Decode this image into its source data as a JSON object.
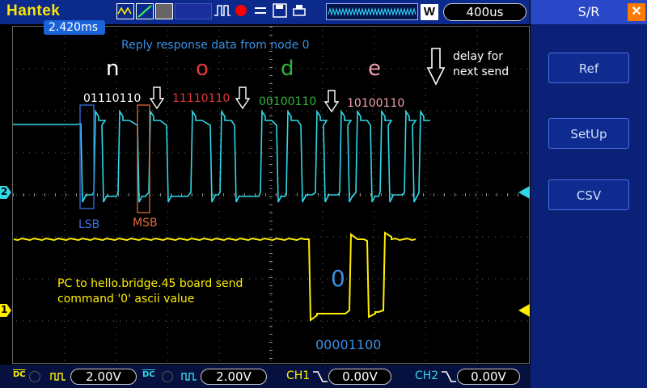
{
  "brand": "Hantek",
  "timebase": "400us",
  "trigger_btn": "W",
  "cursor_time": "2.420ms",
  "right_panel": {
    "title": "S/R",
    "close": "✕",
    "buttons": [
      "Ref",
      "SetUp",
      "CSV"
    ]
  },
  "channel_markers": {
    "ch1": "1",
    "ch2": "2"
  },
  "annotations": {
    "reply": "Reply response data from node 0",
    "letters": [
      "n",
      "o",
      "d",
      "e"
    ],
    "bytes": [
      "01110110",
      "11110110",
      "00100110",
      "10100110"
    ],
    "delay": "delay for next send",
    "lsb": "LSB",
    "msb": "MSB",
    "pc_line1": "PC to hello.bridge.45 board send",
    "pc_line2": "command '0' ascii value",
    "zero_char": "0",
    "zero_bits": "00001100"
  },
  "bottom": {
    "ch1_volt": "2.00V",
    "ch2_volt": "2.00V",
    "ch1_label": "CH1",
    "ch1_level": "0.00V",
    "ch2_label": "CH2",
    "ch2_level": "0.00V",
    "dc": "DC"
  },
  "colors": {
    "ch1": "#ffee00",
    "ch2": "#30d8e8",
    "ann_blue": "#3a8fe0",
    "n": "#ffffff",
    "o": "#e03a3a",
    "d": "#2fb53a",
    "e": "#f0a0b0"
  }
}
